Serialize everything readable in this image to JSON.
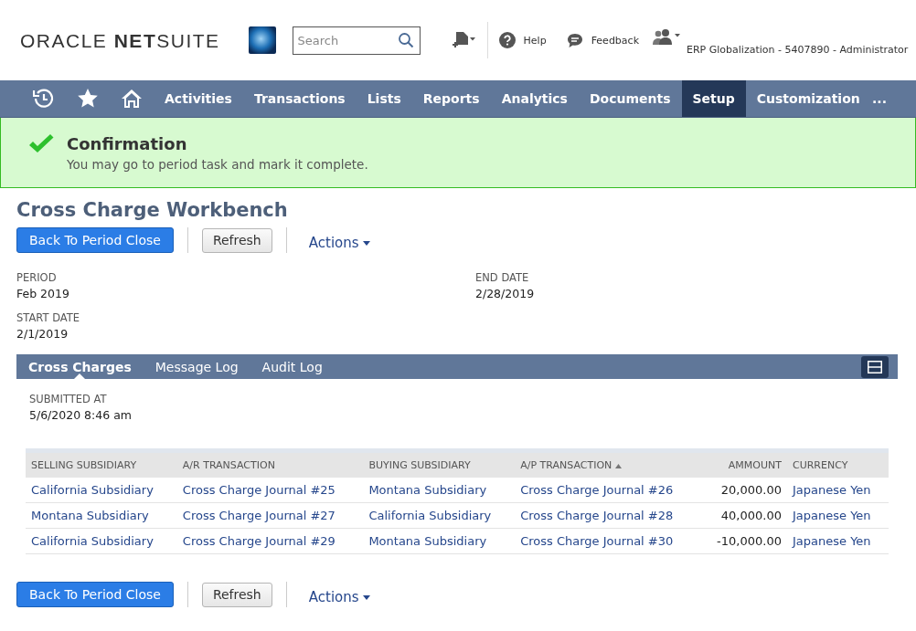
{
  "header": {
    "logo": "ORACLE **NET**SUITE",
    "search": {
      "placeholder": "Search"
    },
    "help": "Help",
    "feedback": "Feedback",
    "account": "ERP Globalization - 5407890 - Administrator"
  },
  "nav": {
    "items": [
      {
        "label": "Activities",
        "selected": false
      },
      {
        "label": "Transactions",
        "selected": false
      },
      {
        "label": "Lists",
        "selected": false
      },
      {
        "label": "Reports",
        "selected": false
      },
      {
        "label": "Analytics",
        "selected": false
      },
      {
        "label": "Documents",
        "selected": false
      },
      {
        "label": "Setup",
        "selected": true
      },
      {
        "label": "Customization",
        "selected": false
      }
    ],
    "more": "..."
  },
  "banner": {
    "title": "Confirmation",
    "message": "You may go to period task and mark it complete."
  },
  "page_title": "Cross Charge Workbench",
  "top_actions": {
    "primary": "Back To Period Close",
    "secondary": "Refresh",
    "menu": "Actions"
  },
  "fields": {
    "column_1": [
      {
        "label": "PERIOD",
        "value": "Feb 2019"
      },
      {
        "label": "START DATE",
        "value": "2/1/2019"
      }
    ],
    "column_2": [
      {
        "label": "END DATE",
        "value": "2/28/2019"
      }
    ]
  },
  "tabs": [
    {
      "label": "Cross Charges",
      "selected": true
    },
    {
      "label": "Message Log",
      "selected": false
    },
    {
      "label": "Audit Log",
      "selected": false
    }
  ],
  "submitted": {
    "label": "SUBMITTED AT",
    "value": "5/6/2020 8:46 am"
  },
  "table": {
    "columns": [
      {
        "label": "SELLING SUBSIDIARY",
        "sorted": false,
        "kind": "link"
      },
      {
        "label": "A/R TRANSACTION",
        "sorted": false,
        "kind": "link"
      },
      {
        "label": "BUYING SUBSIDIARY",
        "sorted": false,
        "kind": "link"
      },
      {
        "label": "A/P TRANSACTION",
        "sorted": true,
        "kind": "link"
      },
      {
        "label": "AMMOUNT",
        "sorted": false,
        "kind": "amount"
      },
      {
        "label": "CURRENCY",
        "sorted": false,
        "kind": "link"
      }
    ],
    "rows": [
      [
        "California Subsidiary",
        "Cross Charge Journal #25",
        "Montana Subsidiary",
        "Cross Charge Journal #26",
        "20,000.00",
        "Japanese Yen"
      ],
      [
        "Montana Subsidiary",
        "Cross Charge Journal #27",
        "California Subsidiary",
        "Cross Charge Journal #28",
        "40,000.00",
        "Japanese Yen"
      ],
      [
        "California Subsidiary",
        "Cross Charge Journal #29",
        "Montana Subsidiary",
        "Cross Charge Journal #30",
        "-10,000.00",
        "Japanese Yen"
      ]
    ]
  },
  "bottom_actions": {
    "primary": "Back To Period Close",
    "secondary": "Refresh",
    "menu": "Actions"
  }
}
